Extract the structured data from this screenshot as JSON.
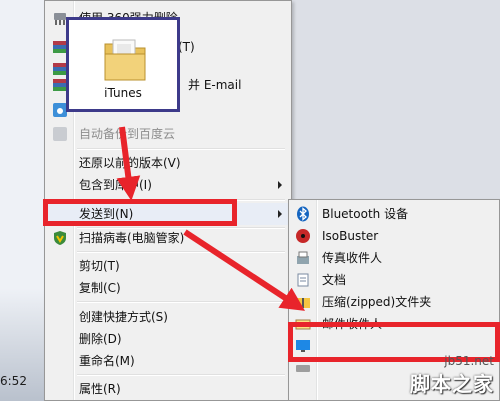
{
  "desktop": {
    "clock": "6:52"
  },
  "context_menu": {
    "items": [
      {
        "label": "使用 360强力删除",
        "icon": "shredder-icon"
      },
      {
        "label": "(T)",
        "icon": "archive-icon"
      },
      {
        "label": "",
        "icon": "archive-icon"
      },
      {
        "label": "并 E-mail",
        "icon": "archive-icon"
      },
      {
        "label": "",
        "icon": "cloud-icon"
      },
      {
        "label": "自动备份到百度云",
        "icon": "cloud-backup-icon"
      },
      {
        "label": "还原以前的版本(V)",
        "icon": ""
      },
      {
        "label": "包含到库中(I)",
        "icon": ""
      },
      {
        "label": "发送到(N)",
        "icon": ""
      },
      {
        "label": "扫描病毒(电脑管家)",
        "icon": "shield-icon"
      },
      {
        "label": "剪切(T)",
        "icon": ""
      },
      {
        "label": "复制(C)",
        "icon": ""
      },
      {
        "label": "创建快捷方式(S)",
        "icon": ""
      },
      {
        "label": "删除(D)",
        "icon": ""
      },
      {
        "label": "重命名(M)",
        "icon": ""
      },
      {
        "label": "属性(R)",
        "icon": ""
      }
    ]
  },
  "send_to_menu": {
    "items": [
      {
        "label": "Bluetooth 设备",
        "icon": "bluetooth-icon"
      },
      {
        "label": "IsoBuster",
        "icon": "isobuster-icon"
      },
      {
        "label": "传真收件人",
        "icon": "fax-icon"
      },
      {
        "label": "文档",
        "icon": "documents-icon"
      },
      {
        "label": "压缩(zipped)文件夹",
        "icon": "zip-folder-icon"
      },
      {
        "label": "邮件收件人",
        "icon": "mail-icon"
      },
      {
        "label": "",
        "icon": "desktop-icon"
      },
      {
        "label": "",
        "icon": "drive-icon"
      }
    ]
  },
  "drag_preview": {
    "label": "iTunes",
    "icon": "folder-icon"
  },
  "watermark": {
    "site": "jb51.net",
    "brand": "脚本之家"
  },
  "colors": {
    "annotation_red": "#e8242b",
    "annotation_box": "#3d3a8a"
  }
}
